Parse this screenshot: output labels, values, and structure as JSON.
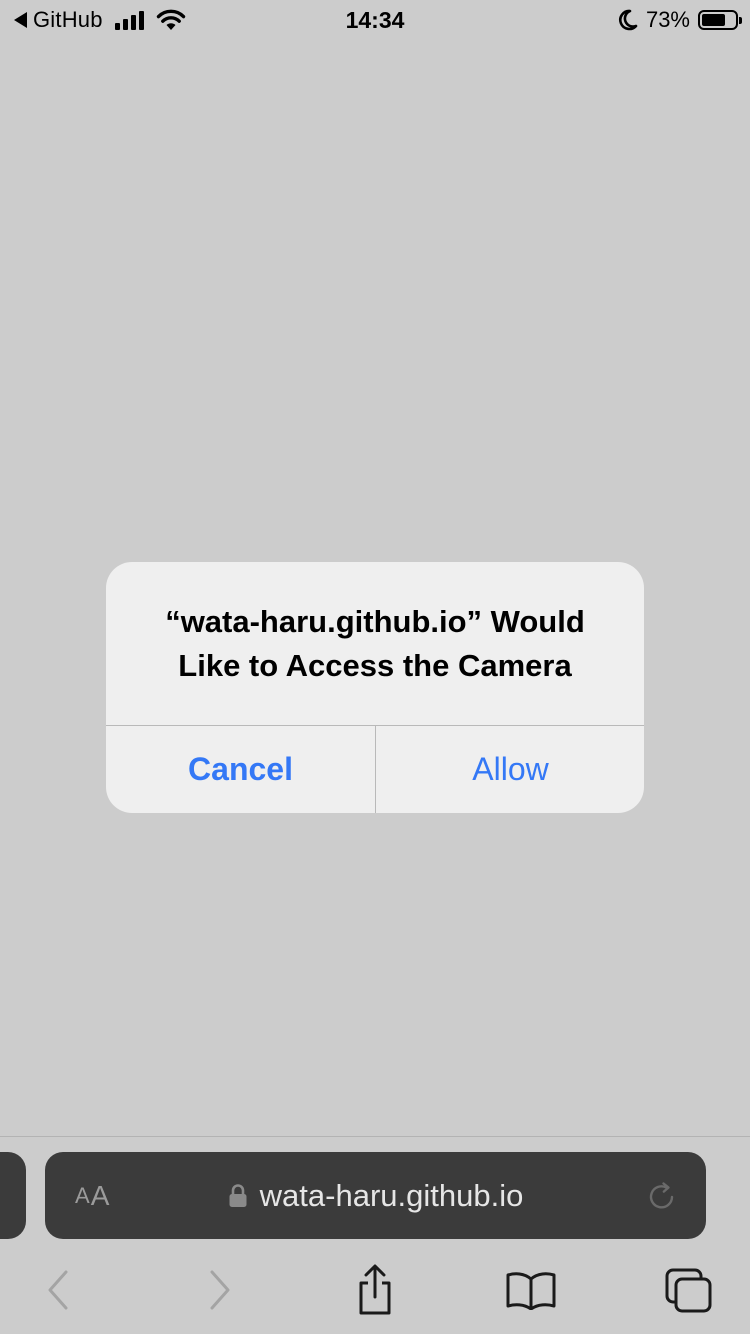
{
  "status_bar": {
    "back_app": "GitHub",
    "time": "14:34",
    "battery_percent": "73%",
    "battery_level": 0.73,
    "icons": [
      "back-triangle-icon",
      "cellular-signal-icon",
      "wifi-icon",
      "do-not-disturb-moon-icon",
      "battery-icon"
    ]
  },
  "alert": {
    "title": "“wata-haru.github.io” Would Like to Access the Camera",
    "cancel_label": "Cancel",
    "allow_label": "Allow",
    "button_color": "#3478f6"
  },
  "address_bar": {
    "text_size_small": "A",
    "text_size_large": "A",
    "url": "wata-haru.github.io",
    "icons": [
      "lock-icon",
      "reload-icon"
    ]
  },
  "toolbar": {
    "icons": [
      "back-chevron-icon",
      "forward-chevron-icon",
      "share-icon",
      "bookmarks-icon",
      "tabs-icon"
    ]
  }
}
